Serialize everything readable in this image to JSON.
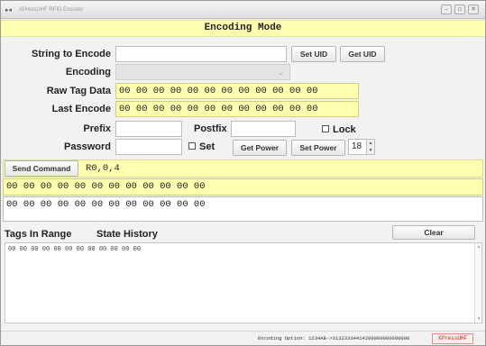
{
  "window": {
    "title": "XPressUHF RFID Encoder",
    "app_icon": "▸◂",
    "controls": [
      "–",
      "▫",
      "✕"
    ]
  },
  "banner": {
    "title": "Encoding Mode"
  },
  "form": {
    "string_to_encode_label": "String to Encode",
    "string_to_encode_value": "",
    "set_uid_label": "Set UID",
    "get_uid_label": "Get UID",
    "encoding_label": "Encoding",
    "encoding_value": "",
    "raw_tag_data_label": "Raw Tag Data",
    "raw_tag_data_value": "00 00 00 00 00 00 00 00 00 00 00 00",
    "last_encode_label": "Last Encode",
    "last_encode_value": "00 00 00 00 00 00 00 00 00 00 00 00",
    "prefix_label": "Prefix",
    "prefix_value": "",
    "postfix_label": "Postfix",
    "postfix_value": "",
    "lock_label": "Lock",
    "password_label": "Password",
    "password_value": "",
    "set_label": "Set",
    "get_power_label": "Get Power",
    "set_power_label": "Set Power",
    "power_value": "18"
  },
  "command": {
    "send_label": "Send Command",
    "command_value": "R0,0,4",
    "response_1": "00 00 00 00 00 00 00 00 00 00 00 00",
    "response_2": "00 00 00 00 00 00 00 00 00 00 00 00"
  },
  "tabs": {
    "tags_in_range": "Tags In Range",
    "state_history": "State History",
    "clear_label": "Clear"
  },
  "tag_list": {
    "lines": [
      "00 00 00 00 00 00 00 00 00 00 00 00"
    ]
  },
  "status": {
    "text": "Encoding Option: 1234AB->31323334414200000000000000",
    "brand": "XPressUHF"
  }
}
